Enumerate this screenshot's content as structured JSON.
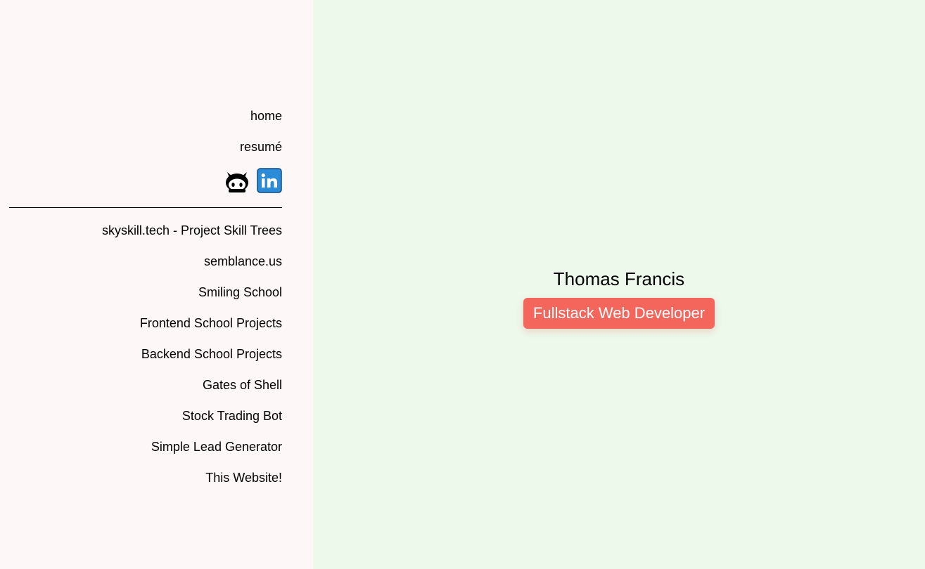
{
  "nav": {
    "items": [
      {
        "label": "home"
      },
      {
        "label": "resumé"
      }
    ],
    "social": [
      {
        "icon": "github-icon"
      },
      {
        "icon": "linkedin-icon"
      }
    ]
  },
  "projects": [
    {
      "label": "skyskill.tech - Project Skill Trees"
    },
    {
      "label": "semblance.us"
    },
    {
      "label": "Smiling School"
    },
    {
      "label": "Frontend School Projects"
    },
    {
      "label": "Backend School Projects"
    },
    {
      "label": "Gates of Shell"
    },
    {
      "label": "Stock Trading Bot"
    },
    {
      "label": "Simple Lead Generator"
    },
    {
      "label": "This Website!"
    }
  ],
  "hero": {
    "name": "Thomas Francis",
    "title": "Fullstack Web Developer"
  },
  "colors": {
    "sidebar_bg": "#fdf7f7",
    "main_bg": "#ecf9eb",
    "badge_bg": "#f4665c",
    "linkedin_blue": "#2c8bd6"
  }
}
